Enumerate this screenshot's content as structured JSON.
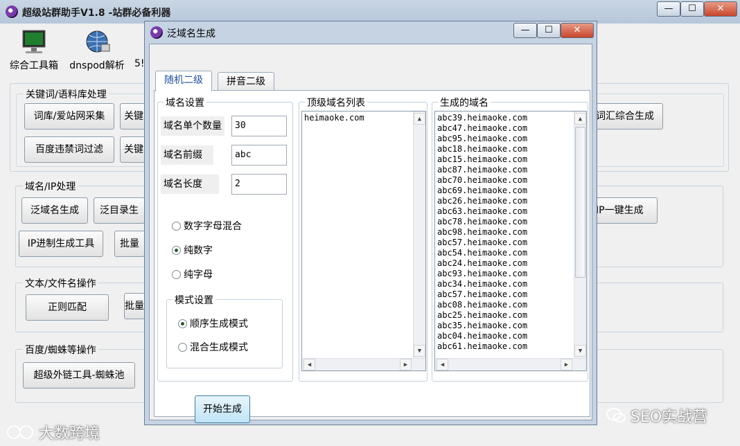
{
  "main_window": {
    "title": "超级站群助手V1.8 -站群必备利器",
    "controls": {
      "minimize": "—",
      "maximize": "☐",
      "close": "✕"
    },
    "toolbar": [
      {
        "label": "综合工具箱",
        "icon": "monitor-icon"
      },
      {
        "label": "dnspod解析",
        "icon": "globe-network-icon"
      },
      {
        "label": "5!"
      }
    ],
    "groups": {
      "keywords": {
        "title": "关键词/语料库处理",
        "buttons": [
          "词库/爱站网采集",
          "关键",
          "百度违禁词过滤",
          "关键",
          "词汇综合生成"
        ]
      },
      "domain_ip": {
        "title": "域名/IP处理",
        "buttons": [
          "泛域名生成",
          "泛目录生",
          "IP进制生成工具",
          "批量",
          "IP一键生成"
        ]
      },
      "text_file": {
        "title": "文本/文件名操作",
        "buttons": [
          "正则匹配",
          "批量"
        ]
      },
      "baidu_spider": {
        "title": "百度/蜘蛛等操作",
        "buttons": [
          "超级外链工具-蜘蛛池"
        ]
      }
    }
  },
  "dialog": {
    "title": "泛域名生成",
    "controls": {
      "minimize": "—",
      "maximize": "☐",
      "close": "✕"
    },
    "tabs": [
      "随机二级",
      "拼音二级"
    ],
    "domain_settings": {
      "title": "域名设置",
      "count_label": "域名单个数量",
      "count_value": "30",
      "prefix_label": "域名前缀",
      "prefix_value": "abc",
      "length_label": "域名长度",
      "length_value": "2",
      "charset_options": [
        "数字字母混合",
        "纯数字",
        "纯字母"
      ],
      "charset_selected": 1
    },
    "mode_settings": {
      "title": "模式设置",
      "options": [
        "顺序生成模式",
        "混合生成模式"
      ],
      "selected": 0
    },
    "top_domains": {
      "title": "顶级域名列表",
      "items": [
        "heimaoke.com"
      ]
    },
    "generated": {
      "title": "生成的域名",
      "items": [
        "abc39.heimaoke.com",
        "abc47.heimaoke.com",
        "abc95.heimaoke.com",
        "abc18.heimaoke.com",
        "abc15.heimaoke.com",
        "abc87.heimaoke.com",
        "abc70.heimaoke.com",
        "abc69.heimaoke.com",
        "abc26.heimaoke.com",
        "abc63.heimaoke.com",
        "abc78.heimaoke.com",
        "abc98.heimaoke.com",
        "abc57.heimaoke.com",
        "abc54.heimaoke.com",
        "abc24.heimaoke.com",
        "abc93.heimaoke.com",
        "abc34.heimaoke.com",
        "abc57.heimaoke.com",
        "abc08.heimaoke.com",
        "abc25.heimaoke.com",
        "abc35.heimaoke.com",
        "abc04.heimaoke.com",
        "abc61.heimaoke.com"
      ]
    },
    "start_button": "开始生成"
  },
  "watermarks": {
    "left": "大数跨境",
    "right": "SEO实战营"
  }
}
